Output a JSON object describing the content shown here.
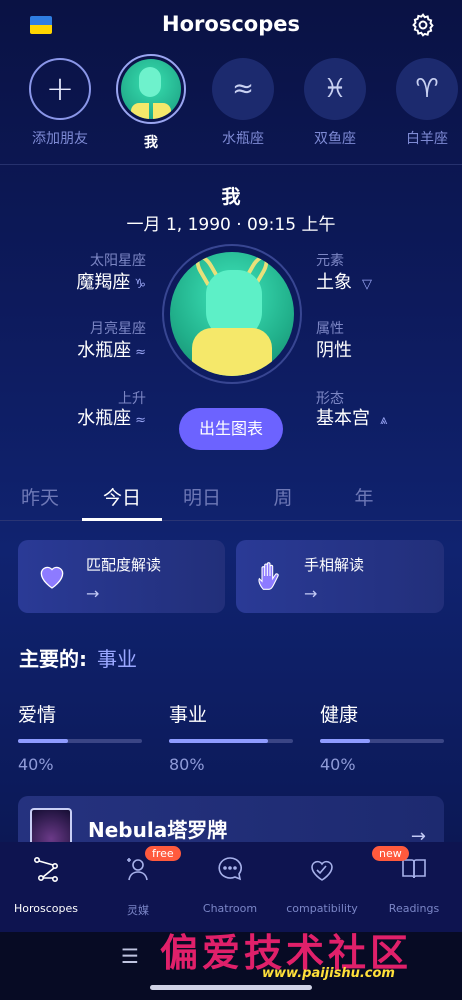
{
  "header": {
    "title": "Horoscopes",
    "flag_icon": "ukraine-flag-icon",
    "settings_icon": "gear-icon"
  },
  "profiles": [
    {
      "label": "添加朋友",
      "icon": "+"
    },
    {
      "label": "我",
      "active": true
    },
    {
      "label": "水瓶座",
      "icon": "≈"
    },
    {
      "label": "双鱼座",
      "icon": "♓︎"
    },
    {
      "label": "白羊座",
      "icon": "♈︎"
    }
  ],
  "birth": {
    "name": "我",
    "datetime": "一月 1, 1990 · 09:15 上午",
    "sun_label": "太阳星座",
    "sun_value": "魔羯座",
    "sun_symbol": "♑︎",
    "moon_label": "月亮星座",
    "moon_value": "水瓶座",
    "moon_symbol": "≈",
    "rising_label": "上升",
    "rising_value": "水瓶座",
    "rising_symbol": "≈",
    "element_label": "元素",
    "element_value": "土象",
    "element_symbol": "▽",
    "quality_label": "属性",
    "quality_value": "阴性",
    "form_label": "形态",
    "form_value": "基本宫",
    "form_symbol": "⩓",
    "chart_button": "出生图表"
  },
  "tabs": [
    "昨天",
    "今日",
    "明日",
    "周",
    "年"
  ],
  "active_tab": "今日",
  "cards": [
    {
      "title": "匹配度解读",
      "arrow": "→",
      "icon": "heart-icon"
    },
    {
      "title": "手相解读",
      "arrow": "→",
      "icon": "palm-icon"
    }
  ],
  "focus": {
    "label": "主要的:",
    "value": "事业"
  },
  "stats": [
    {
      "name": "爱情",
      "percent": "40%",
      "value": 0.4
    },
    {
      "name": "事业",
      "percent": "80%",
      "value": 0.8
    },
    {
      "name": "健康",
      "percent": "40%",
      "value": 0.4
    }
  ],
  "tarot": {
    "title": "Nebula塔罗牌",
    "arrow": "→"
  },
  "nav": [
    {
      "label": "Horoscopes",
      "icon": "constellation-icon",
      "active": true
    },
    {
      "label": "灵媒",
      "icon": "person-sparkle-icon",
      "badge": "free"
    },
    {
      "label": "Chatroom",
      "icon": "chat-bubble-icon"
    },
    {
      "label": "compatibility",
      "icon": "heart-icon"
    },
    {
      "label": "Readings",
      "icon": "book-icon",
      "badge": "new"
    }
  ],
  "system": {
    "menu_glyph": "☰"
  },
  "watermark": {
    "text": "偏爱技术社区",
    "url": "www.paijishu.com"
  }
}
